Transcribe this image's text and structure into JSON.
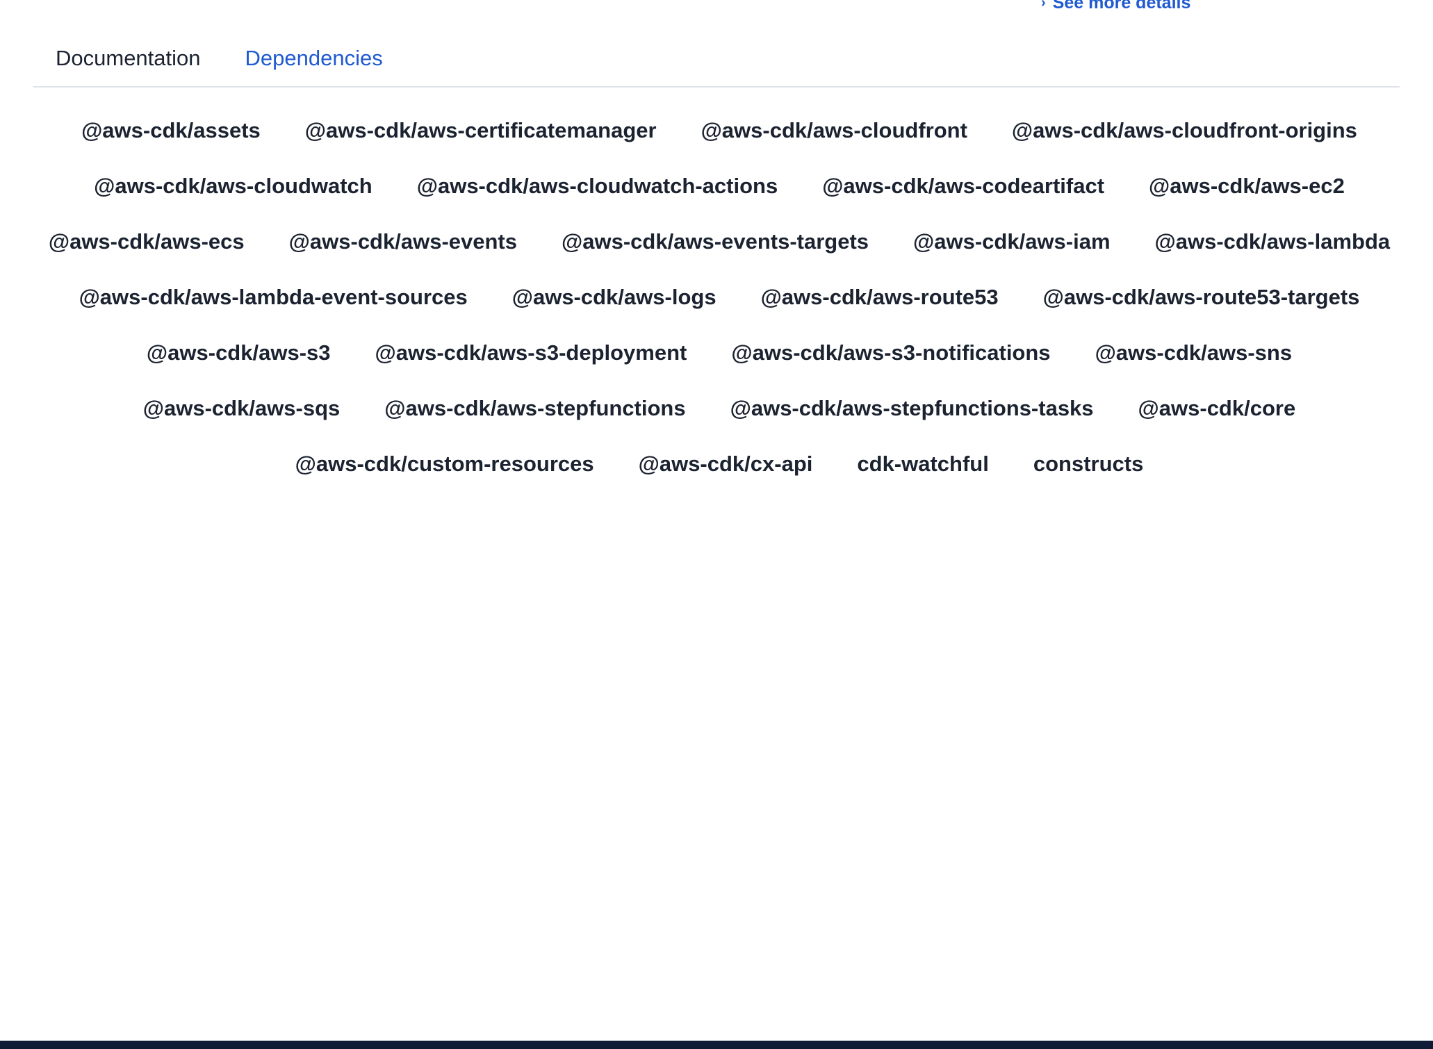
{
  "header": {
    "see_more_label": "See more details",
    "see_more_icon": "chevron-right-icon"
  },
  "tabs": [
    {
      "label": "Documentation",
      "active": false
    },
    {
      "label": "Dependencies",
      "active": true
    }
  ],
  "dependencies": [
    "@aws-cdk/assets",
    "@aws-cdk/aws-certificatemanager",
    "@aws-cdk/aws-cloudfront",
    "@aws-cdk/aws-cloudfront-origins",
    "@aws-cdk/aws-cloudwatch",
    "@aws-cdk/aws-cloudwatch-actions",
    "@aws-cdk/aws-codeartifact",
    "@aws-cdk/aws-ec2",
    "@aws-cdk/aws-ecs",
    "@aws-cdk/aws-events",
    "@aws-cdk/aws-events-targets",
    "@aws-cdk/aws-iam",
    "@aws-cdk/aws-lambda",
    "@aws-cdk/aws-lambda-event-sources",
    "@aws-cdk/aws-logs",
    "@aws-cdk/aws-route53",
    "@aws-cdk/aws-route53-targets",
    "@aws-cdk/aws-s3",
    "@aws-cdk/aws-s3-deployment",
    "@aws-cdk/aws-s3-notifications",
    "@aws-cdk/aws-sns",
    "@aws-cdk/aws-sqs",
    "@aws-cdk/aws-stepfunctions",
    "@aws-cdk/aws-stepfunctions-tasks",
    "@aws-cdk/core",
    "@aws-cdk/custom-resources",
    "@aws-cdk/cx-api",
    "cdk-watchful",
    "constructs"
  ],
  "colors": {
    "accent": "#1f5ad1",
    "text": "#1b2230",
    "divider": "#dfe3ea",
    "footer": "#0f1b36"
  }
}
